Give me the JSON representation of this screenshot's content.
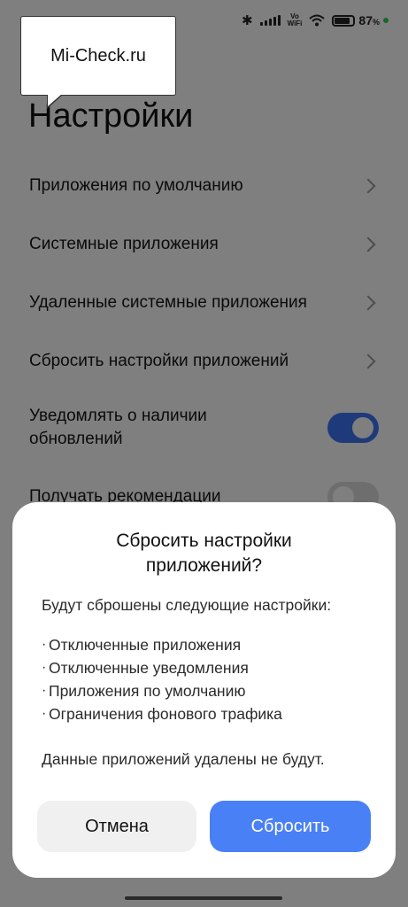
{
  "watermark": {
    "text": "Mi-Check.ru"
  },
  "status_bar": {
    "battery": "87",
    "battery_unit": "%",
    "vowifi_top": "Vo",
    "vowifi_bottom": "WiFi"
  },
  "page": {
    "title": "Настройки"
  },
  "settings": {
    "items": [
      {
        "label": "Приложения по умолчанию",
        "control": "chevron"
      },
      {
        "label": "Системные приложения",
        "control": "chevron"
      },
      {
        "label": "Удаленные системные приложения",
        "control": "chevron"
      },
      {
        "label": "Сбросить настройки приложений",
        "control": "chevron"
      },
      {
        "label_line1": "Уведомлять о наличии",
        "label_line2": "обновлений",
        "control": "toggle",
        "on": true
      },
      {
        "label": "Получать рекомендации",
        "control": "toggle",
        "on": false
      }
    ]
  },
  "dialog": {
    "title_line1": "Сбросить настройки",
    "title_line2": "приложений?",
    "intro": "Будут сброшены следующие настройки:",
    "bullets": [
      "Отключенные приложения",
      "Отключенные уведомления",
      "Приложения по умолчанию",
      "Ограничения фонового трафика"
    ],
    "note": "Данные приложений удалены не будут.",
    "cancel_label": "Отмена",
    "confirm_label": "Сбросить"
  },
  "colors": {
    "accent": "#4a80f5",
    "toggle_on": "#3f74f4",
    "charging": "#2fcf55"
  }
}
